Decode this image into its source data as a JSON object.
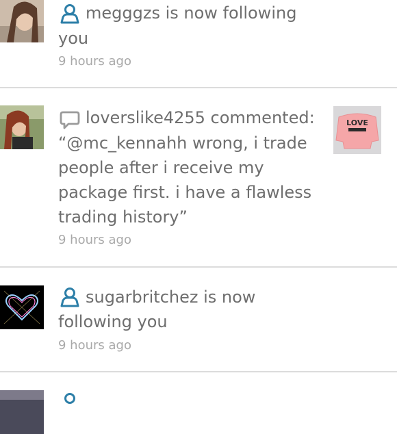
{
  "notifications": [
    {
      "type": "follow",
      "icon": "person-icon",
      "lines": [
        "megggzs is now following",
        "you"
      ],
      "time": "9 hours ago"
    },
    {
      "type": "comment",
      "icon": "speech-bubble-icon",
      "lines": [
        "loverslike4255 commented:",
        "“@mc_kennahh wrong, i trade",
        "people after i receive my",
        "package first. i have a flawless",
        "trading history”"
      ],
      "time": "9 hours ago",
      "thumbnail_text": "LOVE"
    },
    {
      "type": "follow",
      "icon": "person-icon",
      "lines": [
        "sugarbritchez is now",
        "following you"
      ],
      "time": "9 hours ago"
    },
    {
      "type": "follow",
      "icon": "person-icon"
    }
  ],
  "colors": {
    "text": "#6e6e6e",
    "timestamp": "#a9a9a9",
    "icon": "#2d7fa8",
    "comment_icon": "#9a9a9a",
    "divider": "#dcdcdc"
  }
}
